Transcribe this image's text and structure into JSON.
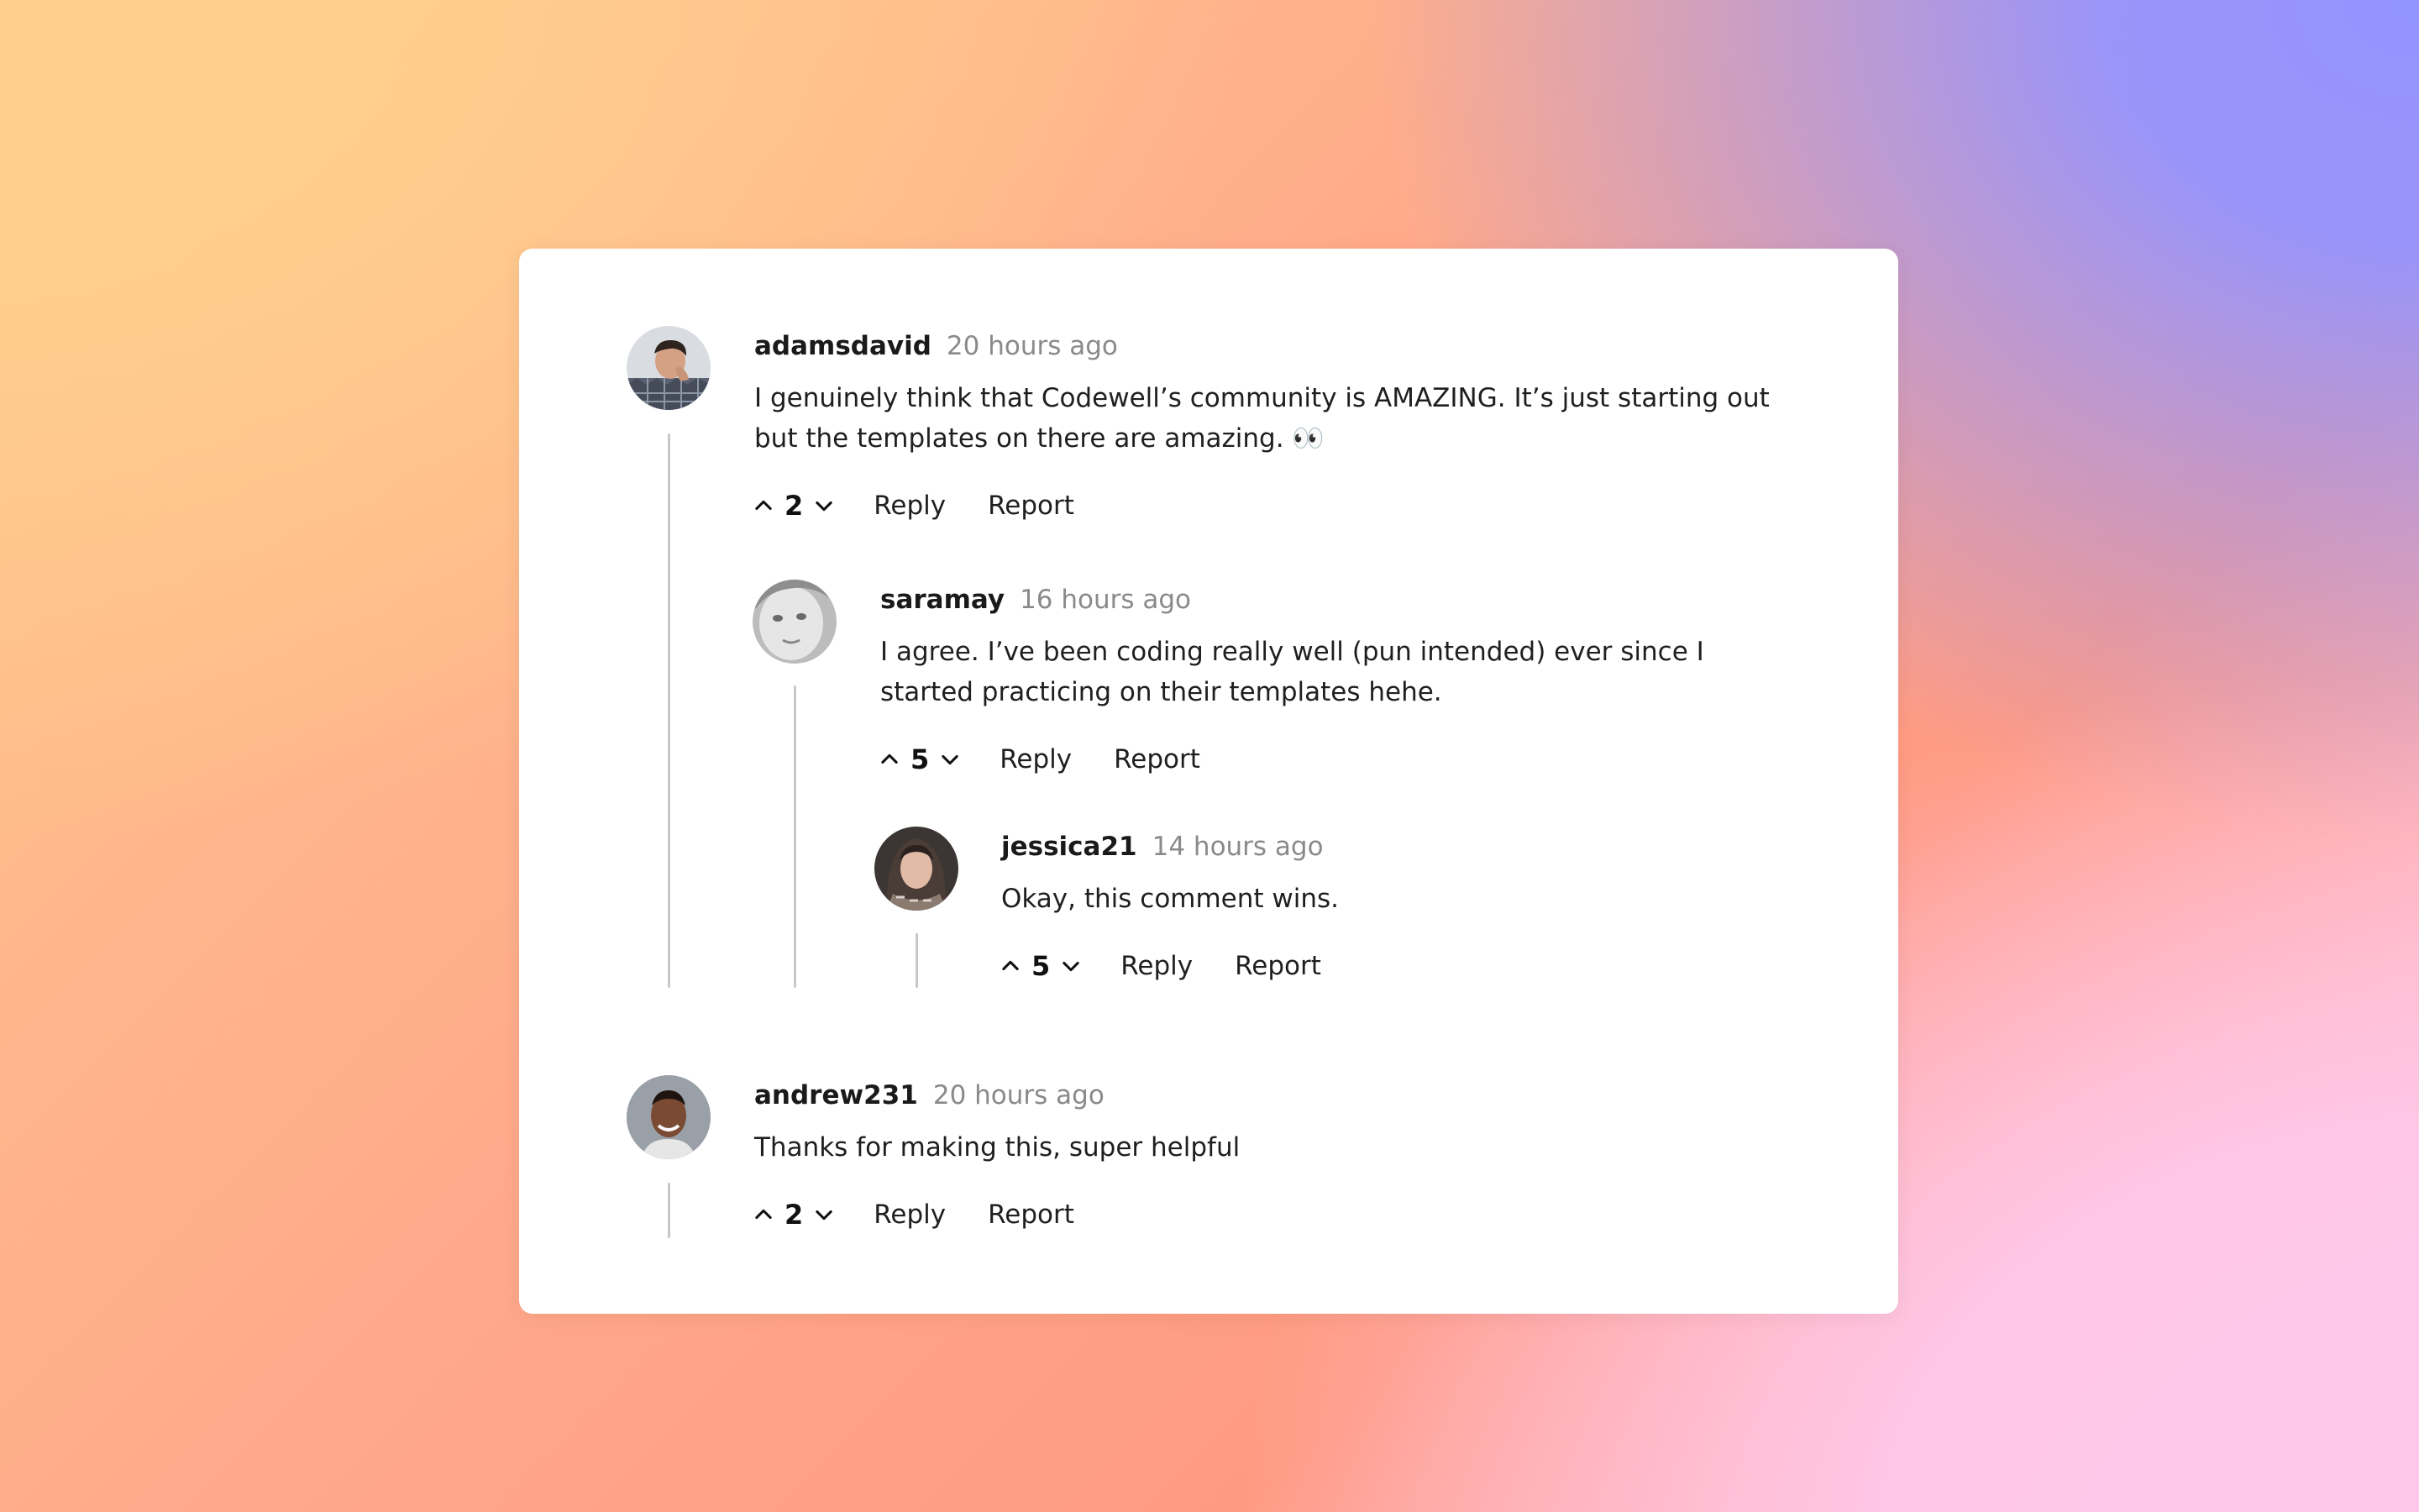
{
  "comments": [
    {
      "username": "adamsdavid",
      "time": "20 hours ago",
      "text": "I genuinely think that Codewell’s community is AMAZING. It’s just starting out but the templates on there are amazing. 👀",
      "votes": "2",
      "reply": "Reply",
      "report": "Report"
    },
    {
      "username": "saramay",
      "time": "16 hours ago",
      "text": "I agree. I’ve been coding really well (pun intended) ever since I started practicing on their templates hehe.",
      "votes": "5",
      "reply": "Reply",
      "report": "Report"
    },
    {
      "username": "jessica21",
      "time": "14 hours ago",
      "text": "Okay, this comment wins.",
      "votes": "5",
      "reply": "Reply",
      "report": "Report"
    },
    {
      "username": "andrew231",
      "time": "20 hours ago",
      "text": "Thanks for making this, super helpful",
      "votes": "2",
      "reply": "Reply",
      "report": "Report"
    }
  ],
  "icons": {
    "upvote": "chevron-up-icon",
    "downvote": "chevron-down-icon"
  },
  "colors": {
    "card_background": "#ffffff",
    "thread_line": "#c8c8c8",
    "username": "#1a1a1a",
    "timestamp": "#8a8a8a"
  }
}
